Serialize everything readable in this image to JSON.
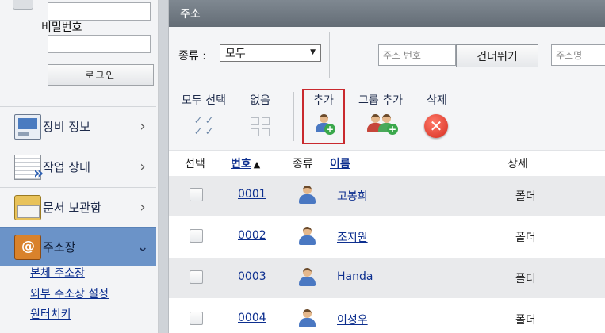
{
  "sidebar": {
    "login": {
      "password_label": "비밀번호",
      "id_value": "",
      "password_value": "",
      "login_button": "로그인"
    },
    "nav_items": [
      {
        "label": "장비 정보",
        "icon": "device-info-icon"
      },
      {
        "label": "작업 상태",
        "icon": "job-status-icon"
      },
      {
        "label": "문서 보관함",
        "icon": "document-box-icon"
      },
      {
        "label": "주소장",
        "icon": "address-book-icon",
        "active": true
      }
    ],
    "sub_links": [
      "본체 주소장",
      "외부 주소장 설정",
      "원터치키"
    ]
  },
  "main": {
    "title": "주소",
    "filter": {
      "type_label": "종류 :",
      "type_value": "모두",
      "address_no_placeholder": "주소 번호",
      "skip_button": "건너뛰기",
      "address_name_placeholder": "주소명"
    },
    "toolbar": {
      "select_all": "모두 선택",
      "none": "없음",
      "add": "추가",
      "add_group": "그룹 추가",
      "delete": "삭제"
    },
    "table": {
      "headers": {
        "select": "선택",
        "number": "번호",
        "sort_indicator": "▲",
        "type": "종류",
        "name": "이름",
        "detail": "상세"
      },
      "rows": [
        {
          "number": "0001",
          "name": "고봉희",
          "detail": "폴더"
        },
        {
          "number": "0002",
          "name": "조지원",
          "detail": "폴더"
        },
        {
          "number": "0003",
          "name": "Handa",
          "detail": "폴더"
        },
        {
          "number": "0004",
          "name": "이성우",
          "detail": "폴더"
        }
      ]
    }
  },
  "colors": {
    "active_nav": "#6b93c8",
    "link": "#0d2f8f",
    "highlight_border": "#c9292e",
    "titlebar": "#6f7881"
  }
}
